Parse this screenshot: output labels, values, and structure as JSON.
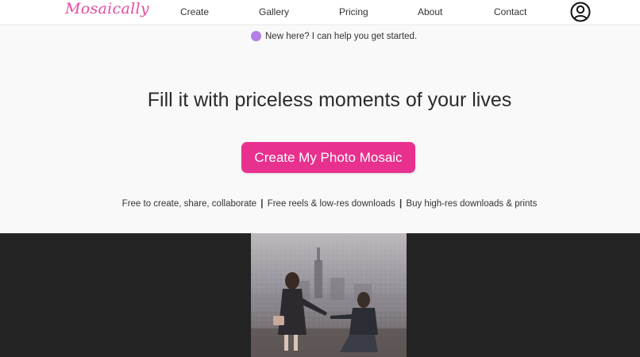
{
  "brand": {
    "logo_text": "Mosaically",
    "accent_color": "#e8308e"
  },
  "nav": {
    "links": [
      {
        "label": "Create"
      },
      {
        "label": "Gallery"
      },
      {
        "label": "Pricing"
      },
      {
        "label": "About"
      },
      {
        "label": "Contact"
      }
    ],
    "account_icon": "user-circle-icon"
  },
  "hero": {
    "helper_text": "New here? I can help you get started.",
    "headline": "Fill it with priceless moments of your lives",
    "cta_label": "Create My Photo Mosaic",
    "benefits": [
      "Free to create, share, collaborate",
      "Free reels & low-res downloads",
      "Buy high-res downloads & prints"
    ],
    "separator": "|"
  },
  "showcase": {
    "image": "photo-mosaic-couple-proposal"
  }
}
